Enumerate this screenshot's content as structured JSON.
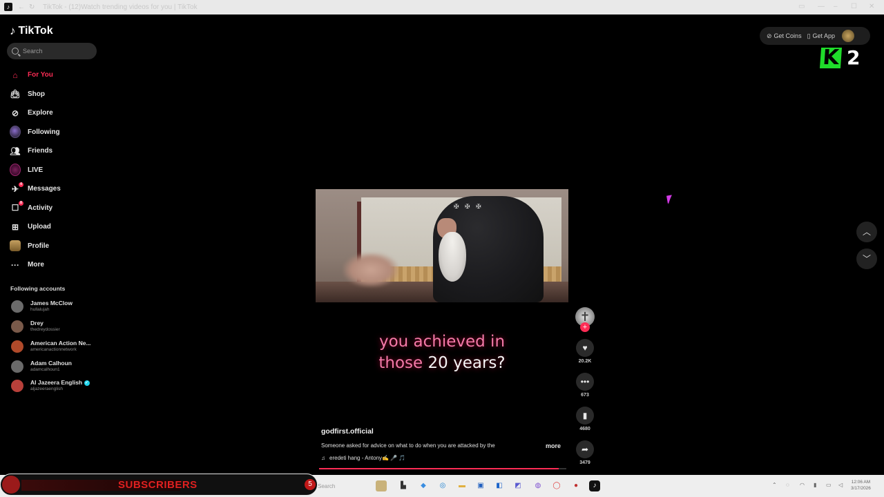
{
  "window": {
    "title": "TikTok - (12)Watch trending videos for you | TikTok"
  },
  "sidebar": {
    "logo_text": "TikTok",
    "search_placeholder": "Search",
    "nav": [
      {
        "label": "For You",
        "icon": "home-icon",
        "active": true
      },
      {
        "label": "Shop",
        "icon": "shopping-bag-icon"
      },
      {
        "label": "Explore",
        "icon": "compass-icon"
      },
      {
        "label": "Following",
        "icon": "following-avatar-icon"
      },
      {
        "label": "Friends",
        "icon": "friends-icon"
      },
      {
        "label": "LIVE",
        "icon": "live-icon"
      },
      {
        "label": "Messages",
        "icon": "messages-icon",
        "badge": "4"
      },
      {
        "label": "Activity",
        "icon": "activity-icon",
        "badge": "8"
      },
      {
        "label": "Upload",
        "icon": "upload-icon"
      },
      {
        "label": "Profile",
        "icon": "profile-avatar-icon"
      },
      {
        "label": "More",
        "icon": "more-dots-icon"
      }
    ],
    "following_title": "Following accounts",
    "accounts": [
      {
        "name": "James McClow",
        "handle": "hullalujah",
        "color": "#6b6b6b"
      },
      {
        "name": "Drey",
        "handle": "thedreydossier",
        "color": "#7a5a4a"
      },
      {
        "name": "American Action Ne...",
        "handle": "americanactionnetwork",
        "color": "#b04a2a"
      },
      {
        "name": "Adam Calhoun",
        "handle": "adamcalhoun1",
        "color": "#6a6a6a"
      },
      {
        "name": "Al Jazeera English",
        "handle": "aljazeeraenglish",
        "color": "#b8403a",
        "verified": true
      }
    ]
  },
  "topbar": {
    "get_coins": "Get Coins",
    "get_app": "Get App"
  },
  "overlay": {
    "k_logo": "K",
    "k_number": "2"
  },
  "video": {
    "caption_pink_1": "you achieved in",
    "caption_pink_2": "those",
    "caption_white": "20 years?",
    "author": "godfirst.official",
    "description": "Someone asked for advice on what to do when you are attacked by the",
    "more": "more",
    "music": "eredeti hang - Antony✍️ 🎤 🎵",
    "progress": 0.97,
    "likes": "20.2K",
    "comments": "673",
    "saves": "4680",
    "shares": "3479"
  },
  "stream": {
    "subscribers_label": "SUBSCRIBERS",
    "subscribers_count": "5"
  },
  "taskbar": {
    "search_placeholder": "Search",
    "time": "12:06 AM",
    "date": "3/17/2026"
  },
  "colors": {
    "accent": "#fe2c55",
    "k_green": "#1fdc2a"
  }
}
